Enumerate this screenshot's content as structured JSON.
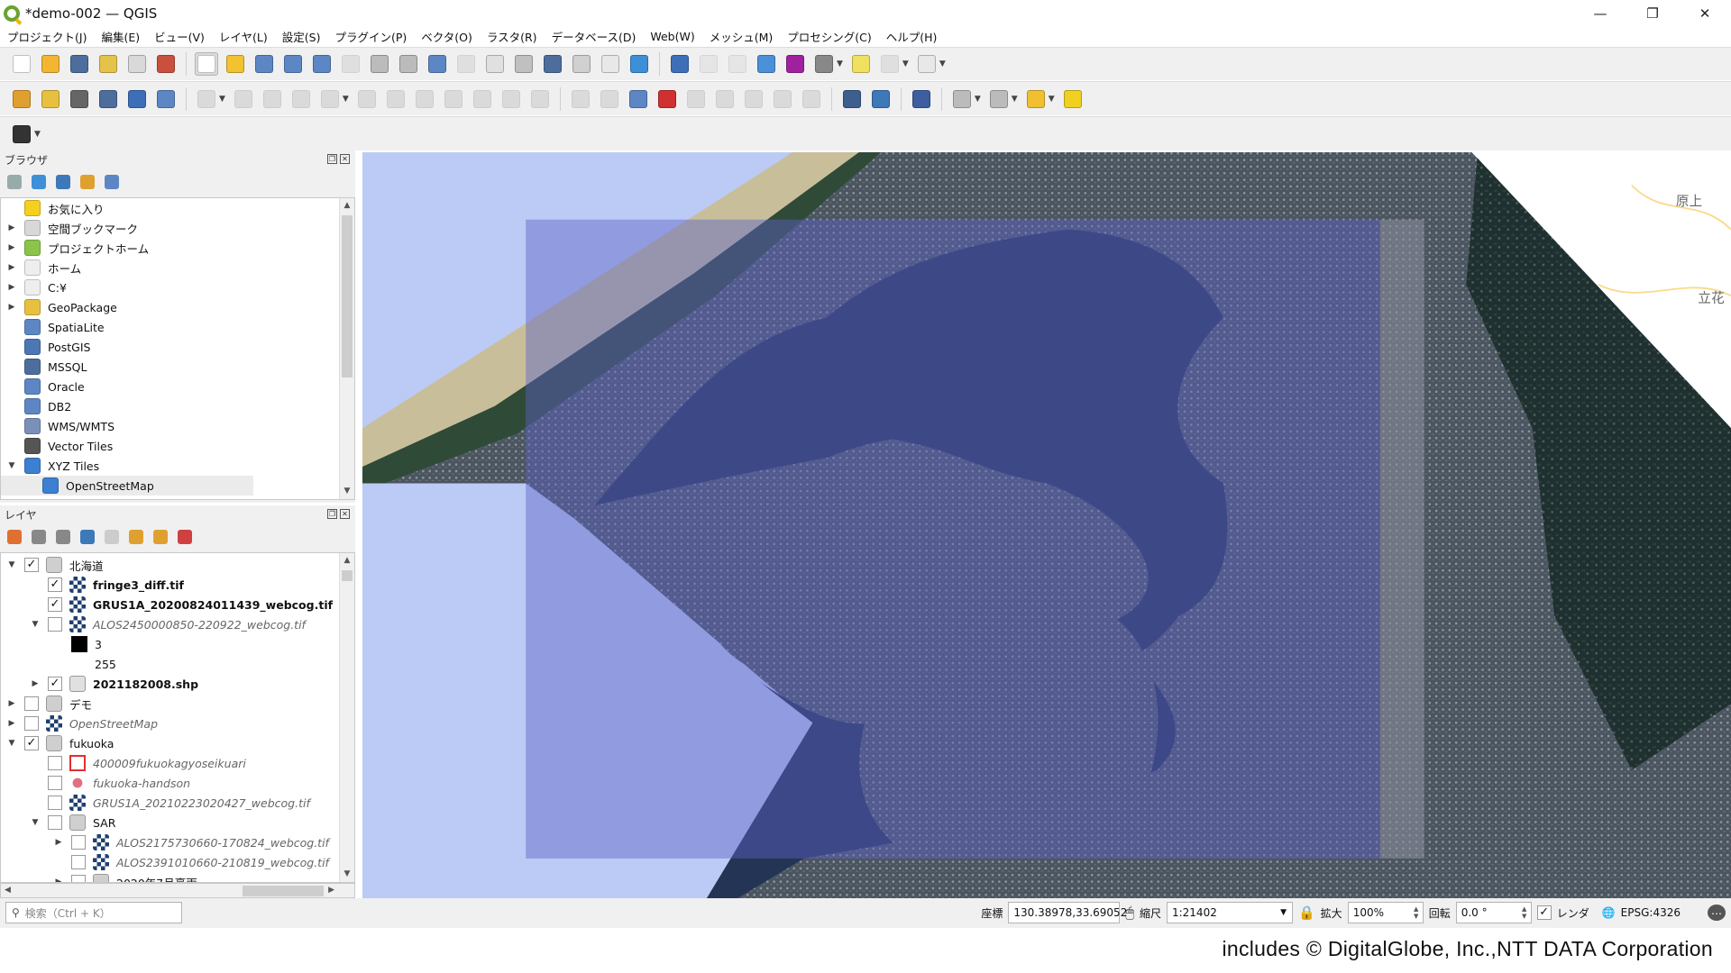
{
  "window": {
    "title": "*demo-002 — QGIS",
    "minimize": "—",
    "restore": "❐",
    "close": "✕"
  },
  "menu": [
    "プロジェクト(J)",
    "編集(E)",
    "ビュー(V)",
    "レイヤ(L)",
    "設定(S)",
    "プラグイン(P)",
    "ベクタ(O)",
    "ラスタ(R)",
    "データベース(D)",
    "Web(W)",
    "メッシュ(M)",
    "プロセシング(C)",
    "ヘルプ(H)"
  ],
  "toolbars": [
    [
      {
        "icon": "new-project-icon",
        "color": "#ffffff"
      },
      {
        "icon": "open-project-icon",
        "color": "#f2b632"
      },
      {
        "icon": "save-project-icon",
        "color": "#4d6e9c"
      },
      {
        "icon": "new-print-layout-icon",
        "color": "#e5c34a"
      },
      {
        "icon": "layout-manager-icon",
        "color": "#d9d9d9"
      },
      {
        "icon": "style-manager-icon",
        "color": "#c8503c"
      },
      "sep",
      {
        "icon": "pan-icon",
        "color": "#ffffff",
        "active": true
      },
      {
        "icon": "pan-to-selection-icon",
        "color": "#f2c230"
      },
      {
        "icon": "zoom-in-icon",
        "color": "#5d87c4"
      },
      {
        "icon": "zoom-out-icon",
        "color": "#5d87c4"
      },
      {
        "icon": "zoom-full-icon",
        "color": "#5d87c4"
      },
      {
        "icon": "zoom-to-selection-icon",
        "color": "#bbbbbb",
        "disabled": true
      },
      {
        "icon": "zoom-to-layer-icon",
        "color": "#bbbbbb"
      },
      {
        "icon": "zoom-native-icon",
        "color": "#bbbbbb"
      },
      {
        "icon": "zoom-last-icon",
        "color": "#5d87c4"
      },
      {
        "icon": "zoom-next-icon",
        "color": "#bbbbbb",
        "disabled": true
      },
      {
        "icon": "new-map-view-icon",
        "color": "#e0e0e0"
      },
      {
        "icon": "new-3d-view-icon",
        "color": "#c0c0c0"
      },
      {
        "icon": "new-bookmark-icon",
        "color": "#4d6e9c"
      },
      {
        "icon": "show-bookmarks-icon",
        "color": "#d0d0d0"
      },
      {
        "icon": "temporal-controller-icon",
        "color": "#e8e8e8"
      },
      {
        "icon": "refresh-icon",
        "color": "#3d8fd8"
      },
      "sep",
      {
        "icon": "identify-icon",
        "color": "#3d6fb8"
      },
      {
        "icon": "attribute-table-icon",
        "color": "#cccccc",
        "disabled": true
      },
      {
        "icon": "field-calculator-icon",
        "color": "#cccccc",
        "disabled": true
      },
      {
        "icon": "processing-toolbox-icon",
        "color": "#4a90d9"
      },
      {
        "icon": "statistics-icon",
        "color": "#a020a0"
      },
      {
        "icon": "measure-icon",
        "color": "#888888",
        "drop": true
      },
      {
        "icon": "map-tips-icon",
        "color": "#f0e060"
      },
      {
        "icon": "locator-icon",
        "color": "#bbbbbb",
        "drop": true,
        "disabled": true
      },
      {
        "icon": "text-annotation-icon",
        "color": "#e8e8e8",
        "drop": true
      }
    ],
    [
      {
        "icon": "data-source-manager-icon",
        "color": "#e0a030"
      },
      {
        "icon": "new-geopackage-icon",
        "color": "#e8c040"
      },
      {
        "icon": "new-shapefile-icon",
        "color": "#666666"
      },
      {
        "icon": "new-spatialite-icon",
        "color": "#4d6e9c"
      },
      {
        "icon": "new-temp-layer-icon",
        "color": "#3d6fb8"
      },
      {
        "icon": "new-virtual-layer-icon",
        "color": "#5d87c4"
      },
      "sep",
      {
        "icon": "current-edits-icon",
        "color": "#aaaaaa",
        "disabled": true,
        "drop": true
      },
      {
        "icon": "toggle-editing-icon",
        "color": "#aaaaaa",
        "disabled": true
      },
      {
        "icon": "save-edits-icon",
        "color": "#aaaaaa",
        "disabled": true
      },
      {
        "icon": "add-feature-icon",
        "color": "#aaaaaa",
        "disabled": true
      },
      {
        "icon": "vertex-tool-icon",
        "color": "#aaaaaa",
        "disabled": true,
        "drop": true
      },
      {
        "icon": "modify-attributes-icon",
        "color": "#aaaaaa",
        "disabled": true
      },
      {
        "icon": "delete-selected-icon",
        "color": "#aaaaaa",
        "disabled": true
      },
      {
        "icon": "cut-features-icon",
        "color": "#aaaaaa",
        "disabled": true
      },
      {
        "icon": "copy-features-icon",
        "color": "#aaaaaa",
        "disabled": true
      },
      {
        "icon": "paste-features-icon",
        "color": "#aaaaaa",
        "disabled": true
      },
      {
        "icon": "undo-icon",
        "color": "#aaaaaa",
        "disabled": true
      },
      {
        "icon": "redo-icon",
        "color": "#aaaaaa",
        "disabled": true
      },
      "sep",
      {
        "icon": "label-toolbar-icon",
        "color": "#aaaaaa",
        "disabled": true
      },
      {
        "icon": "pin-labels-icon",
        "color": "#aaaaaa",
        "disabled": true
      },
      {
        "icon": "layer-labeling-icon",
        "color": "#5d87c4"
      },
      {
        "icon": "rule-labeling-icon",
        "color": "#d03030"
      },
      {
        "icon": "highlight-pinned-icon",
        "color": "#aaaaaa",
        "disabled": true
      },
      {
        "icon": "show-hide-labels-icon",
        "color": "#aaaaaa",
        "disabled": true
      },
      {
        "icon": "move-label-icon",
        "color": "#aaaaaa",
        "disabled": true
      },
      {
        "icon": "rotate-label-icon",
        "color": "#aaaaaa",
        "disabled": true
      },
      {
        "icon": "change-label-icon",
        "color": "#aaaaaa",
        "disabled": true
      },
      "sep",
      {
        "icon": "globe-binoculars-icon",
        "color": "#3d5f8f"
      },
      {
        "icon": "python-console-icon",
        "color": "#3d78b8"
      },
      "sep",
      {
        "icon": "help-icon",
        "color": "#3d5f9f"
      },
      "sep",
      {
        "icon": "select-features-icon",
        "color": "#bbbbbb",
        "drop": true
      },
      {
        "icon": "select-by-value-icon",
        "color": "#bbbbbb",
        "drop": true
      },
      {
        "icon": "deselect-all-icon",
        "color": "#f0c030",
        "drop": true
      },
      {
        "icon": "select-by-location-icon",
        "color": "#f0d020"
      }
    ],
    [
      {
        "icon": "reload-spinner-icon",
        "color": "#333333",
        "drop": true
      }
    ]
  ],
  "browser": {
    "title": "ブラウザ",
    "tools": [
      {
        "icon": "add-selected-icon",
        "color": "#9aa"
      },
      {
        "icon": "refresh-icon",
        "color": "#3d8fd8"
      },
      {
        "icon": "filter-icon",
        "color": "#3d78b8"
      },
      {
        "icon": "collapse-all-icon",
        "color": "#e0a030"
      },
      {
        "icon": "info-icon",
        "color": "#5d87c4"
      }
    ],
    "items": [
      {
        "label": "お気に入り",
        "icon": "star-icon",
        "color": "#f5d020",
        "exp": ""
      },
      {
        "label": "空間ブックマーク",
        "icon": "bookmark-icon",
        "color": "#d8d8d8",
        "exp": "right"
      },
      {
        "label": "プロジェクトホーム",
        "icon": "project-home-icon",
        "color": "#8cc34a",
        "exp": "right"
      },
      {
        "label": "ホーム",
        "icon": "home-folder-icon",
        "color": "#eeeeee",
        "exp": "right"
      },
      {
        "label": "C:¥",
        "icon": "folder-icon",
        "color": "#eeeeee",
        "exp": "right"
      },
      {
        "label": "GeoPackage",
        "icon": "geopackage-icon",
        "color": "#e8c040",
        "exp": "right"
      },
      {
        "label": "SpatiaLite",
        "icon": "spatialite-icon",
        "color": "#5d87c4",
        "exp": ""
      },
      {
        "label": "PostGIS",
        "icon": "postgis-elephant-icon",
        "color": "#4d77b4",
        "exp": ""
      },
      {
        "label": "MSSQL",
        "icon": "mssql-icon",
        "color": "#4d6e9c",
        "exp": ""
      },
      {
        "label": "Oracle",
        "icon": "oracle-icon",
        "color": "#5d87c4",
        "exp": ""
      },
      {
        "label": "DB2",
        "icon": "db2-icon",
        "color": "#5d87c4",
        "exp": ""
      },
      {
        "label": "WMS/WMTS",
        "icon": "wms-globe-icon",
        "color": "#7a90b8",
        "exp": ""
      },
      {
        "label": "Vector Tiles",
        "icon": "vector-tiles-icon",
        "color": "#555555",
        "exp": ""
      },
      {
        "label": "XYZ Tiles",
        "icon": "xyz-tiles-icon",
        "color": "#3d7fd0",
        "exp": "down"
      },
      {
        "label": "OpenStreetMap",
        "icon": "xyz-tiles-icon",
        "color": "#3d7fd0",
        "exp": "",
        "level": 1,
        "selected": true
      }
    ]
  },
  "layers": {
    "title": "レイヤ",
    "tools": [
      {
        "icon": "open-styling-icon",
        "color": "#e07030"
      },
      {
        "icon": "add-group-icon",
        "color": "#888"
      },
      {
        "icon": "manage-visibility-icon",
        "color": "#888"
      },
      {
        "icon": "filter-legend-icon",
        "color": "#3d78b8"
      },
      {
        "icon": "filter-expression-icon",
        "color": "#ccc"
      },
      {
        "icon": "expand-all-icon",
        "color": "#e0a030"
      },
      {
        "icon": "collapse-all-icon",
        "color": "#e0a030"
      },
      {
        "icon": "remove-layer-icon",
        "color": "#d04040"
      }
    ],
    "items": [
      {
        "level": 0,
        "exp": "down",
        "checked": true,
        "icon": "group-icon",
        "color": "#cfcfcf",
        "label": "北海道",
        "style": "normal"
      },
      {
        "level": 1,
        "exp": "",
        "checked": true,
        "icon": "raster-icon",
        "color": "#1f3f6f",
        "label": "fringe3_diff.tif",
        "style": "bold"
      },
      {
        "level": 1,
        "exp": "",
        "checked": true,
        "icon": "raster-icon",
        "color": "#1f3f6f",
        "label": "GRUS1A_20200824011439_webcog.tif",
        "style": "bold"
      },
      {
        "level": 1,
        "exp": "down",
        "checked": false,
        "icon": "raster-icon",
        "color": "#1f3f6f",
        "label": "ALOS2450000850-220922_webcog.tif",
        "style": "italic"
      },
      {
        "level": 2,
        "exp": "",
        "checked": null,
        "icon": "legend-swatch-black",
        "color": "#000000",
        "label": "3",
        "style": "normal"
      },
      {
        "level": 2,
        "exp": "",
        "checked": null,
        "icon": "",
        "color": "",
        "label": "255",
        "style": "normal"
      },
      {
        "level": 1,
        "exp": "right",
        "checked": true,
        "icon": "polygon-layer-icon",
        "color": "#e0e0e0",
        "label": "2021182008.shp",
        "style": "bold"
      },
      {
        "level": 0,
        "exp": "right",
        "checked": false,
        "icon": "group-icon",
        "color": "#cfcfcf",
        "label": "デモ",
        "style": "normal"
      },
      {
        "level": 0,
        "exp": "right",
        "checked": false,
        "icon": "raster-icon",
        "color": "#1f3f6f",
        "label": "OpenStreetMap",
        "style": "italic"
      },
      {
        "level": 0,
        "exp": "down",
        "checked": true,
        "icon": "group-icon",
        "color": "#cfcfcf",
        "label": "fukuoka",
        "style": "normal"
      },
      {
        "level": 1,
        "exp": "",
        "checked": false,
        "icon": "polygon-outline-red-icon",
        "color": "#e03030",
        "label": "400009fukuokagyoseikuari",
        "style": "italic"
      },
      {
        "level": 1,
        "exp": "",
        "checked": false,
        "icon": "point-pink-icon",
        "color": "#e07080",
        "label": "fukuoka-handson",
        "style": "italic"
      },
      {
        "level": 1,
        "exp": "",
        "checked": false,
        "icon": "raster-icon",
        "color": "#1f3f6f",
        "label": "GRUS1A_20210223020427_webcog.tif",
        "style": "italic"
      },
      {
        "level": 1,
        "exp": "down",
        "checked": false,
        "icon": "group-icon",
        "color": "#cfcfcf",
        "label": "SAR",
        "style": "normal"
      },
      {
        "level": 2,
        "exp": "right",
        "checked": false,
        "icon": "raster-icon",
        "color": "#1f3f6f",
        "label": "ALOS2175730660-170824_webcog.tif",
        "style": "italic"
      },
      {
        "level": 2,
        "exp": "",
        "checked": false,
        "icon": "raster-icon",
        "color": "#1f3f6f",
        "label": "ALOS2391010660-210819_webcog.tif",
        "style": "italic"
      },
      {
        "level": 2,
        "exp": "right",
        "checked": false,
        "icon": "group-icon",
        "color": "#cfcfcf",
        "label": "2020年7月豪雨",
        "style": "normal"
      }
    ]
  },
  "search": {
    "placeholder": "検索（Ctrl + K）"
  },
  "status": {
    "coord_label": "座標",
    "coord": "130.38978,33.69052",
    "scale_label": "縮尺",
    "scale": "1:21402",
    "magnifier_label": "拡大",
    "magnifier": "100%",
    "rotation_label": "回転",
    "rotation": "0.0 °",
    "render_label": "レンダ",
    "render_checked": true,
    "crs": "EPSG:4326"
  },
  "map": {
    "labels": [
      "原上",
      "立花"
    ]
  },
  "attribution": "includes © DigitalGlobe, Inc.,NTT DATA Corporation"
}
